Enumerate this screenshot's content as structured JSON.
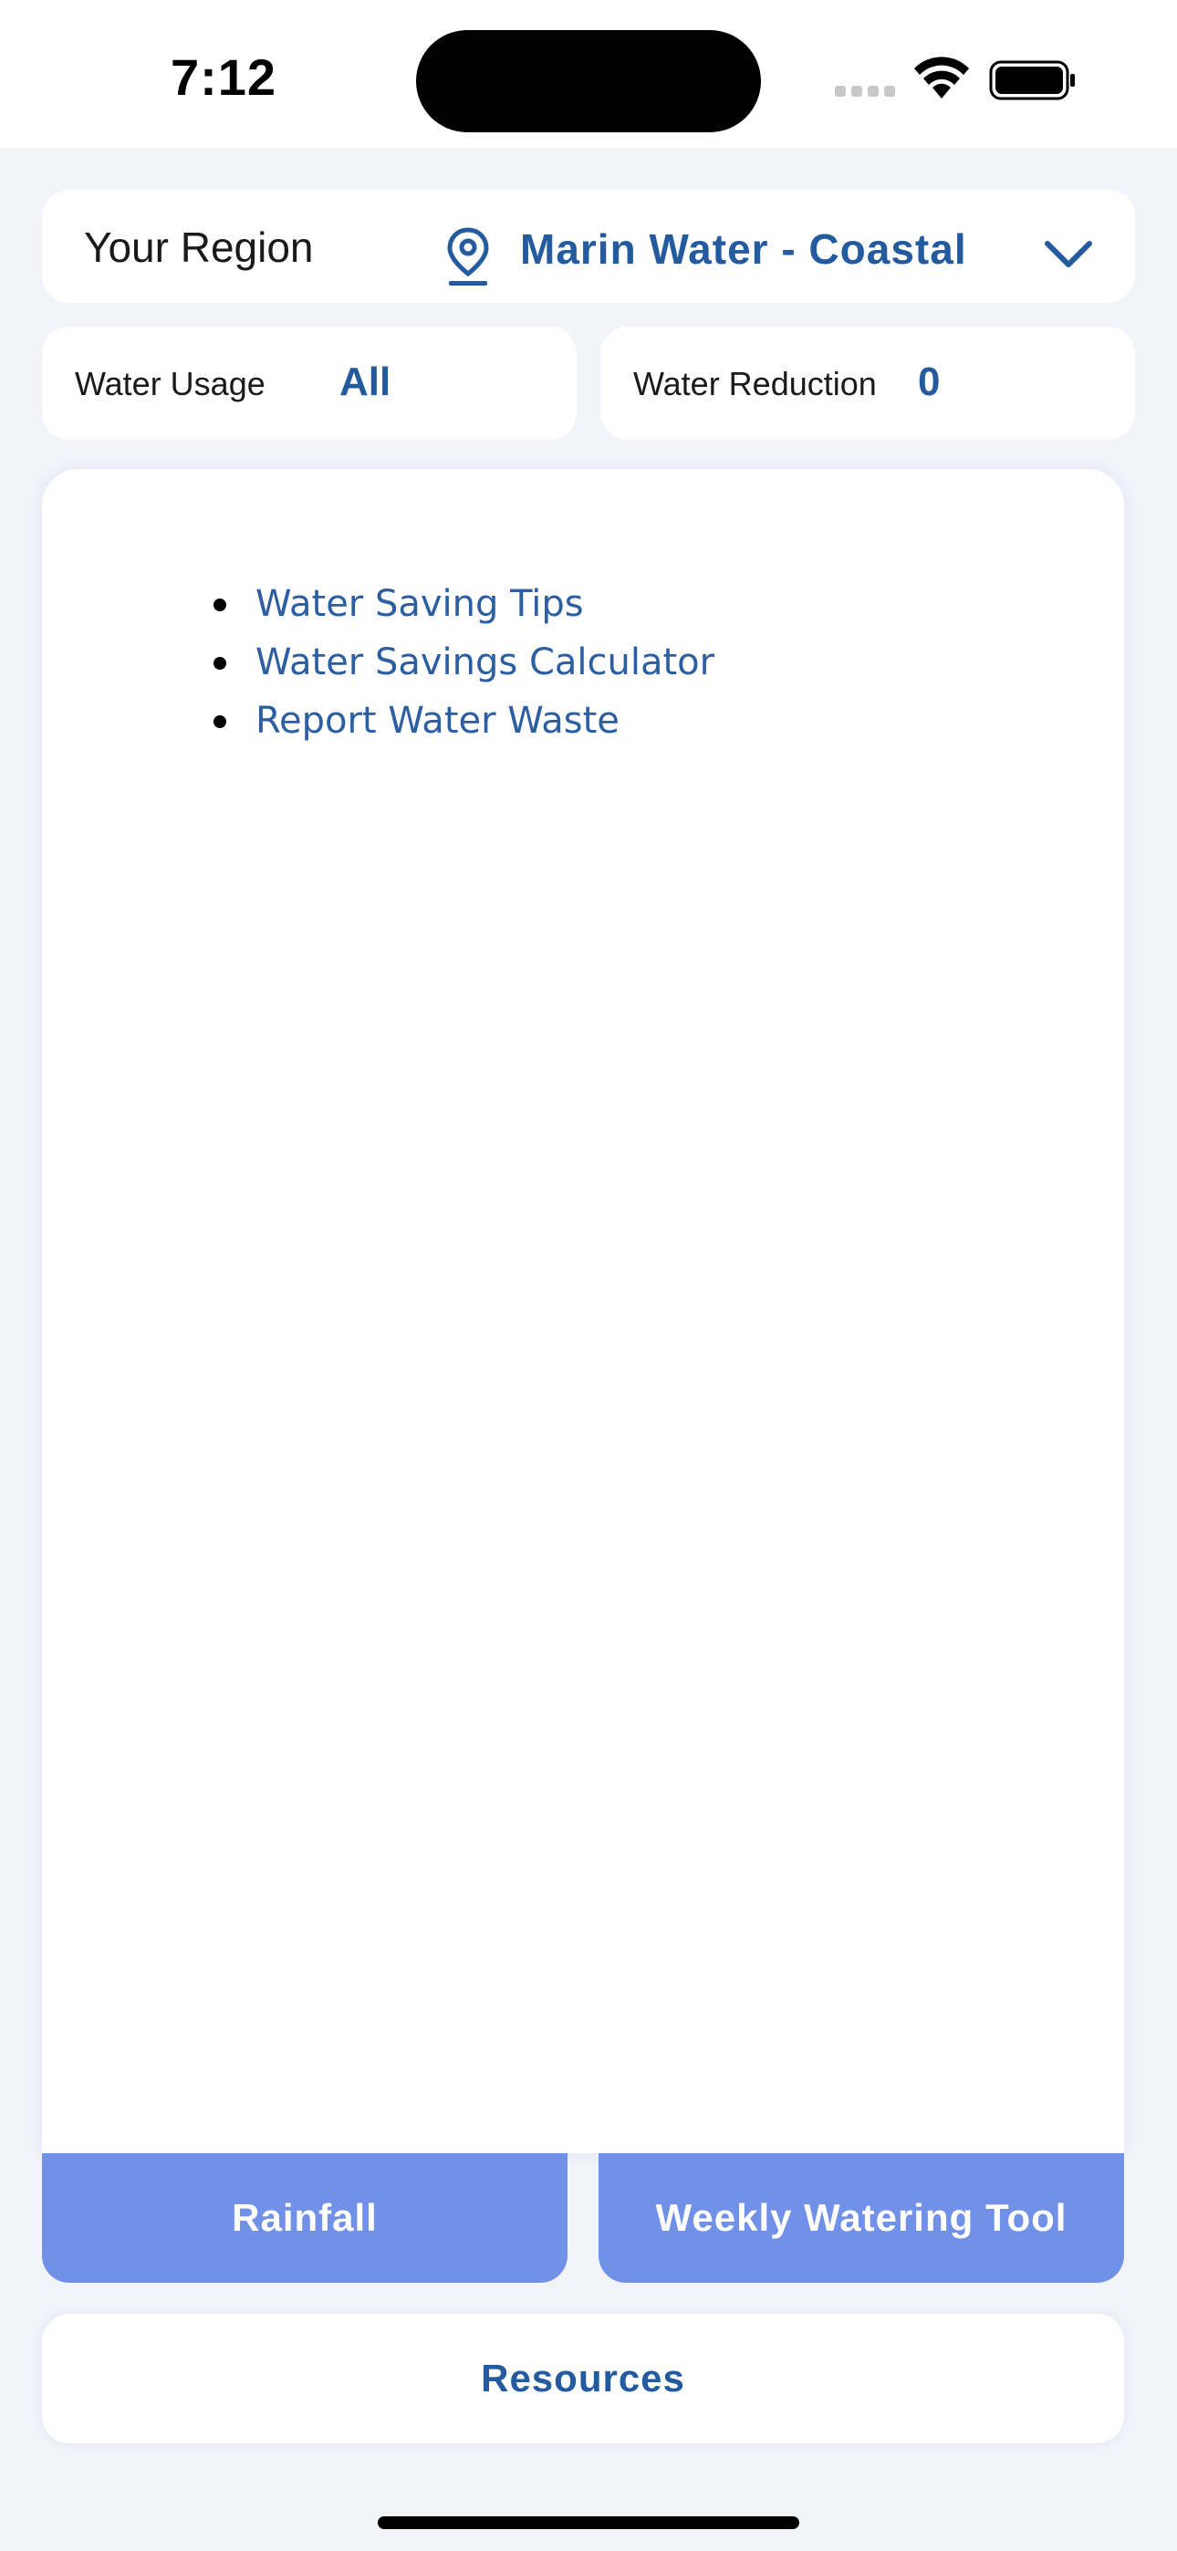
{
  "status_bar": {
    "time": "7:12",
    "icons": [
      "cellular-signal-icon",
      "wifi-icon",
      "battery-icon"
    ]
  },
  "region": {
    "label": "Your Region",
    "value": "Marin Water - Coastal",
    "icons": [
      "location-pin-icon",
      "chevron-down-icon"
    ]
  },
  "stats": {
    "usage_label": "Water Usage",
    "usage_value": "All",
    "reduction_label": "Water Reduction",
    "reduction_value": "0"
  },
  "links": [
    "Water Saving Tips",
    "Water Savings Calculator",
    "Report Water Waste"
  ],
  "buttons": {
    "rainfall": "Rainfall",
    "weekly_watering": "Weekly Watering Tool",
    "resources": "Resources"
  },
  "colors": {
    "accent": "#245A9E",
    "tab_button": "#7190E8",
    "background": "#F2F4FA"
  }
}
